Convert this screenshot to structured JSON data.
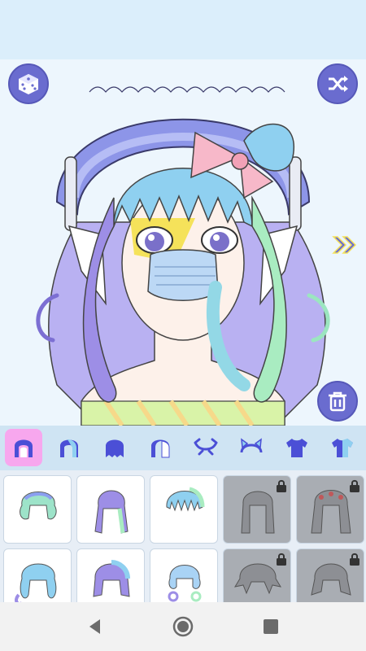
{
  "app": {
    "screen": "avatar-maker-hair"
  },
  "toolbar": {
    "dice_icon": "dice-icon",
    "shuffle_icon": "shuffle-icon",
    "next_icon": "double-chevron-right-icon",
    "delete_icon": "trash-icon"
  },
  "categories": [
    {
      "icon": "hair-front-icon",
      "active": true
    },
    {
      "icon": "hair-front-alt-icon",
      "active": false
    },
    {
      "icon": "hair-back-icon",
      "active": false
    },
    {
      "icon": "hair-side-icon",
      "active": false
    },
    {
      "icon": "horns-icon",
      "active": false
    },
    {
      "icon": "ears-icon",
      "active": false
    },
    {
      "icon": "shirt-icon",
      "active": false
    },
    {
      "icon": "shirt-alt-icon",
      "active": false
    }
  ],
  "hair_items": [
    {
      "style": "hair-style-1",
      "locked": false
    },
    {
      "style": "hair-style-2",
      "locked": false
    },
    {
      "style": "hair-style-3",
      "locked": false
    },
    {
      "style": "hair-style-4",
      "locked": true
    },
    {
      "style": "hair-style-5",
      "locked": true
    },
    {
      "style": "hair-style-6",
      "locked": false
    },
    {
      "style": "hair-style-7",
      "locked": false
    },
    {
      "style": "hair-style-8",
      "locked": false
    },
    {
      "style": "hair-style-9",
      "locked": true
    },
    {
      "style": "hair-style-10",
      "locked": true
    }
  ],
  "colors": {
    "accent": "#6a6ccf",
    "active_tab": "#f7a7ee",
    "hair_blue": "#8fd0f0",
    "hair_purple": "#9d8ee6",
    "hair_green": "#a9ecc1",
    "bonnet": "#8d95e8",
    "bow": "#f7b8c9"
  }
}
